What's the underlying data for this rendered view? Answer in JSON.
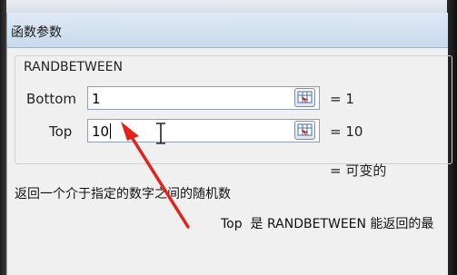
{
  "dialog": {
    "title": "函数参数",
    "function_name": "RANDBETWEEN",
    "args": [
      {
        "label": "Bottom",
        "value": "1",
        "result": "=  1"
      },
      {
        "label": "Top",
        "value": "10",
        "result": "=  10"
      }
    ],
    "overall_result": "=  可变的",
    "description": "返回一个介于指定的数字之间的随机数",
    "arg_help_name": "Top",
    "arg_help_text": "是 RANDBETWEEN 能返回的最"
  },
  "icons": {
    "collapse": "collapse-dialog-icon",
    "cursor": "text-cursor-icon",
    "annotation": "red-arrow-annotation"
  },
  "colors": {
    "arrow": "#e2231a",
    "titlebar": "#c9d9ec",
    "dialog_bg": "#f0f0f0"
  }
}
